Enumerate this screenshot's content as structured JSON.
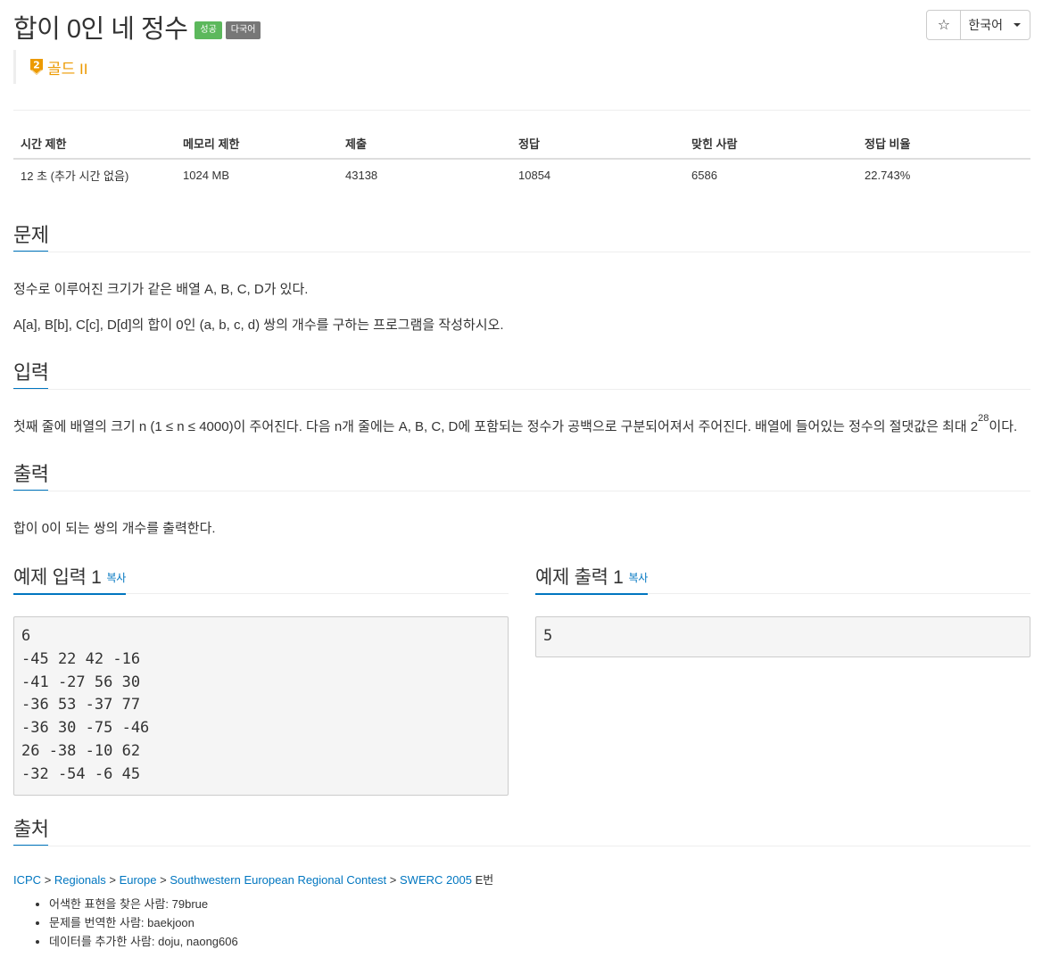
{
  "problem": {
    "title": "합이 0인 네 정수",
    "badges": {
      "success": "성공",
      "multilang": "다국어"
    },
    "tier": "골드 II",
    "tier_level": "2",
    "tier_color": "#ec9a00"
  },
  "toolbar": {
    "star_icon": "☆",
    "language": "한국어"
  },
  "stats": {
    "headers": [
      "시간 제한",
      "메모리 제한",
      "제출",
      "정답",
      "맞힌 사람",
      "정답 비율"
    ],
    "values": [
      "12 초 (추가 시간 없음)",
      "1024 MB",
      "43138",
      "10854",
      "6586",
      "22.743%"
    ]
  },
  "sections": {
    "problem": {
      "heading": "문제",
      "lines": [
        "정수로 이루어진 크기가 같은 배열 A, B, C, D가 있다.",
        "A[a], B[b], C[c], D[d]의 합이 0인 (a, b, c, d) 쌍의 개수를 구하는 프로그램을 작성하시오."
      ]
    },
    "input": {
      "heading": "입력",
      "text_before": "첫째 줄에 배열의 크기 n (1 ≤ n ≤ 4000)이 주어진다. 다음 n개 줄에는 A, B, C, D에 포함되는 정수가 공백으로 구분되어져서 주어진다. 배열에 들어있는 정수의 절댓값은 최대 2",
      "sup": "28",
      "text_after": "이다."
    },
    "output": {
      "heading": "출력",
      "text": "합이 0이 되는 쌍의 개수를 출력한다."
    }
  },
  "samples": {
    "input": {
      "heading": "예제 입력 1",
      "copy": "복사",
      "content": "6\n-45 22 42 -16\n-41 -27 56 30\n-36 53 -37 77\n-36 30 -75 -46\n26 -38 -10 62\n-32 -54 -6 45"
    },
    "output": {
      "heading": "예제 출력 1",
      "copy": "복사",
      "content": "5"
    }
  },
  "source": {
    "heading": "출처",
    "path": [
      "ICPC",
      "Regionals",
      "Europe",
      "Southwestern European Regional Contest",
      "SWERC 2005"
    ],
    "separator": ">",
    "suffix": "E번",
    "credits": [
      "어색한 표현을 찾은 사람: 79brue",
      "문제를 번역한 사람: baekjoon",
      "데이터를 추가한 사람: doju, naong606"
    ]
  }
}
